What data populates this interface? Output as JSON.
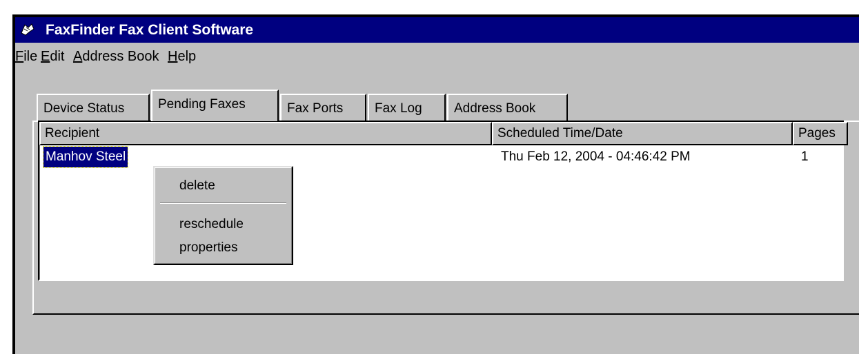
{
  "window": {
    "title": "FaxFinder Fax Client Software",
    "title_icon": "fax-app-icon",
    "titlebar_color": "#000080",
    "background": "#c0c0c0"
  },
  "menu": {
    "file": {
      "accel": "F",
      "rest": "ile"
    },
    "edit": {
      "accel": "E",
      "rest": "dit"
    },
    "address_book": {
      "accel": "A",
      "rest": "ddress Book"
    },
    "help": {
      "accel": "H",
      "rest": "elp"
    }
  },
  "tabs": [
    {
      "label": "Device Status",
      "active": false
    },
    {
      "label": "Pending Faxes",
      "active": true
    },
    {
      "label": "Fax Ports",
      "active": false
    },
    {
      "label": "Fax Log",
      "active": false
    },
    {
      "label": "Address Book",
      "active": false
    }
  ],
  "table": {
    "columns": [
      "Recipient",
      "Scheduled Time/Date",
      "Pages"
    ],
    "rows": [
      {
        "recipient": "Manhov Steel",
        "scheduled": "Thu Feb 12, 2004 - 04:46:42 PM",
        "pages": "1",
        "selected": true
      }
    ]
  },
  "context_menu": {
    "items": [
      "delete",
      "reschedule",
      "properties"
    ]
  }
}
